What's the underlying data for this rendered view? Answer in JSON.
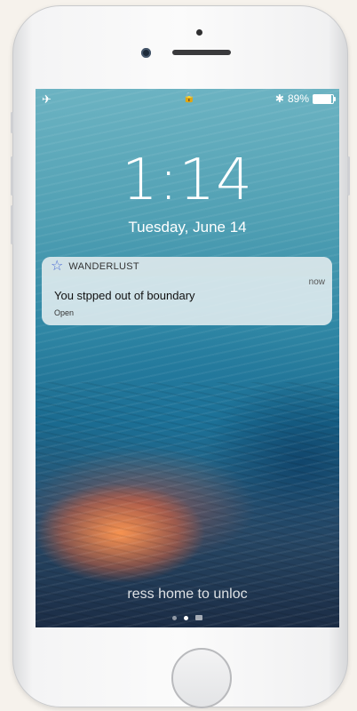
{
  "status_bar": {
    "left_icons": "airplane-icon wifi-icon",
    "left_glyphs": "✈ ︎",
    "lock_glyph": "🔒",
    "bluetooth_glyph": "✱",
    "battery_percent": "89%",
    "battery_level": 0.89
  },
  "lockscreen": {
    "time": "1:14",
    "date": "Tuesday, June 14",
    "unlock_hint": "ress home to unloc"
  },
  "notification": {
    "app_icon_glyph": "☆",
    "app_name": "WANDERLUST",
    "time": "now",
    "message": "You stpped out of boundary",
    "action": "Open"
  },
  "colors": {
    "phone_frame": "#f4f4f5",
    "page_background": "#f6f2ec",
    "app_accent": "#4b6bd6"
  }
}
